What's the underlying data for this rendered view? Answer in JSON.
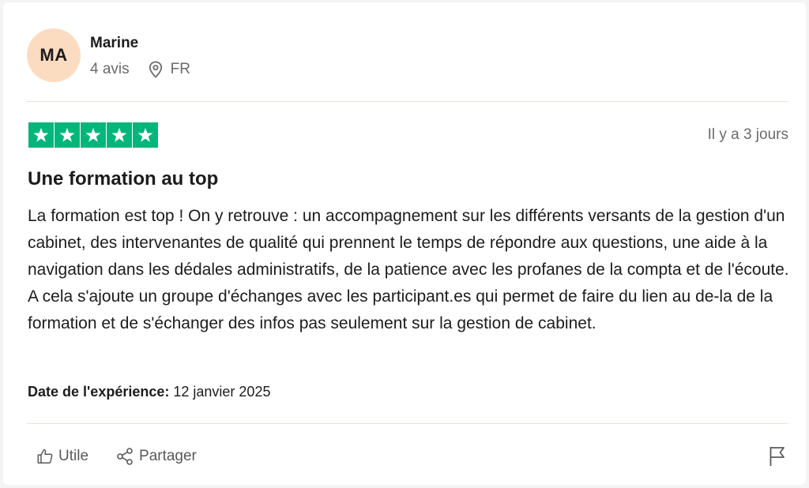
{
  "reviewer": {
    "initials": "MA",
    "name": "Marine",
    "review_count": "4 avis",
    "country": "FR",
    "avatar_color": "#fcdcc1"
  },
  "rating": {
    "stars": 5,
    "max_stars": 5,
    "star_color": "#00b67a",
    "relative_date": "Il y a 3 jours"
  },
  "review": {
    "title": "Une formation au top",
    "text": "La formation est top ! On y retrouve : un accompagnement sur les différents versants de la gestion d'un cabinet, des intervenantes de qualité qui prennent le temps de répondre aux questions, une aide à la navigation dans les dédales administratifs, de la patience avec les profanes de la compta et de l'écoute. A cela s'ajoute un groupe d'échanges avec les participant.es qui permet de faire du lien au de-la de la formation et de s'échanger des infos pas seulement sur la gestion de cabinet.",
    "experience_label": "Date de l'expérience:",
    "experience_date": "12 janvier 2025"
  },
  "actions": {
    "useful_label": "Utile",
    "useful_icon": "thumbs-up-icon",
    "share_label": "Partager",
    "share_icon": "share-icon",
    "report_icon": "flag-icon"
  }
}
